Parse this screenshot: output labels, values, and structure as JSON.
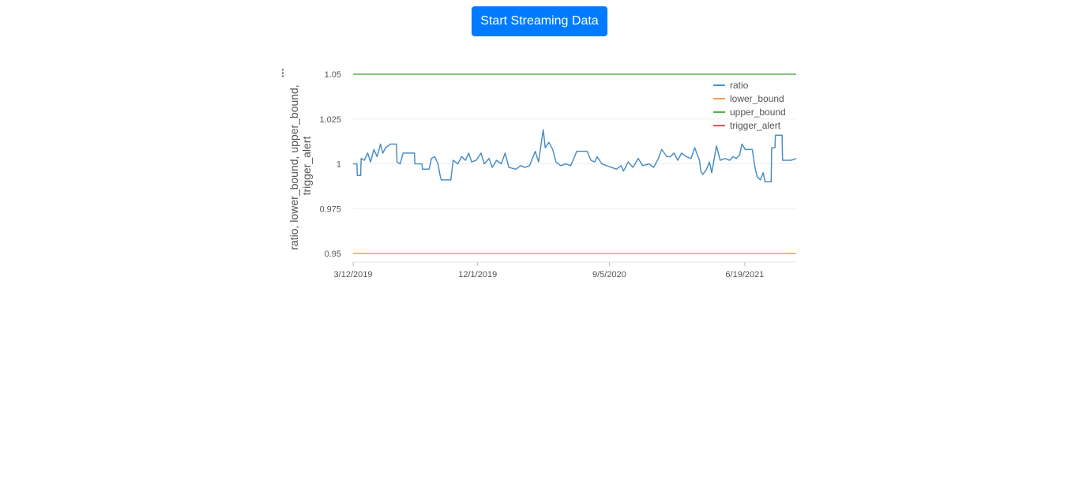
{
  "toolbar": {
    "stream_label": "Start Streaming Data"
  },
  "menu": {
    "icon": "kebab-menu-icon"
  },
  "colors": {
    "button": "#007bff",
    "ratio": "#4c8fc4",
    "lower_bound": "#f5a04a",
    "upper_bound": "#5aae52",
    "trigger_alert": "#e8524a"
  },
  "chart_data": {
    "type": "line",
    "title": "",
    "xlabel": "",
    "ylabel": "ratio, lower_bound, upper_bound, trigger_alert",
    "ylabel_lines": [
      "ratio, lower_bound, upper_bound,",
      "trigger_alert"
    ],
    "x_range": [
      "2019-03-12",
      "2021-10-06"
    ],
    "x_ticks": [
      "3/12/2019",
      "12/1/2019",
      "9/5/2020",
      "6/19/2021"
    ],
    "x_tick_dates": [
      "2019-03-12",
      "2019-12-01",
      "2020-09-05",
      "2021-06-19"
    ],
    "ylim": [
      0.95,
      1.05
    ],
    "y_ticks": [
      "1.05",
      "1.025",
      "1",
      "0.975",
      "0.95"
    ],
    "y_tick_values": [
      1.05,
      1.025,
      1.0,
      0.975,
      0.95
    ],
    "grid": true,
    "legend_position": "top-right",
    "series": [
      {
        "name": "ratio",
        "color": "#4c8fc4",
        "points": [
          [
            "2019-03-12",
            1.0
          ],
          [
            "2019-03-20",
            1.0
          ],
          [
            "2019-03-21",
            0.9935
          ],
          [
            "2019-03-28",
            0.9935
          ],
          [
            "2019-03-29",
            1.003
          ],
          [
            "2019-04-05",
            1.002
          ],
          [
            "2019-04-12",
            1.006
          ],
          [
            "2019-04-18",
            1.001
          ],
          [
            "2019-04-25",
            1.008
          ],
          [
            "2019-05-02",
            1.004
          ],
          [
            "2019-05-09",
            1.011
          ],
          [
            "2019-05-14",
            1.006
          ],
          [
            "2019-05-20",
            1.009
          ],
          [
            "2019-05-30",
            1.011
          ],
          [
            "2019-06-12",
            1.011
          ],
          [
            "2019-06-13",
            1.001
          ],
          [
            "2019-06-20",
            1.0
          ],
          [
            "2019-06-26",
            1.006
          ],
          [
            "2019-07-20",
            1.006
          ],
          [
            "2019-07-21",
            1.0
          ],
          [
            "2019-08-05",
            1.0
          ],
          [
            "2019-08-06",
            0.997
          ],
          [
            "2019-08-20",
            0.997
          ],
          [
            "2019-08-25",
            1.003
          ],
          [
            "2019-09-01",
            1.004
          ],
          [
            "2019-09-08",
            1.0
          ],
          [
            "2019-09-12",
            0.994
          ],
          [
            "2019-09-15",
            0.991
          ],
          [
            "2019-10-05",
            0.991
          ],
          [
            "2019-10-10",
            1.002
          ],
          [
            "2019-10-20",
            1.0
          ],
          [
            "2019-10-28",
            1.004
          ],
          [
            "2019-11-05",
            1.002
          ],
          [
            "2019-11-12",
            1.006
          ],
          [
            "2019-11-18",
            1.001
          ],
          [
            "2019-11-28",
            1.002
          ],
          [
            "2019-12-08",
            1.006
          ],
          [
            "2019-12-15",
            1.0
          ],
          [
            "2019-12-25",
            1.003
          ],
          [
            "2020-01-01",
            0.998
          ],
          [
            "2020-01-10",
            1.002
          ],
          [
            "2020-01-20",
            1.0
          ],
          [
            "2020-01-28",
            1.006
          ],
          [
            "2020-02-05",
            0.998
          ],
          [
            "2020-02-20",
            0.997
          ],
          [
            "2020-03-01",
            0.999
          ],
          [
            "2020-03-10",
            0.998
          ],
          [
            "2020-03-20",
            0.999
          ],
          [
            "2020-04-01",
            1.007
          ],
          [
            "2020-04-08",
            1.001
          ],
          [
            "2020-04-15",
            1.014
          ],
          [
            "2020-04-18",
            1.019
          ],
          [
            "2020-04-22",
            1.009
          ],
          [
            "2020-04-30",
            1.012
          ],
          [
            "2020-05-08",
            1.008
          ],
          [
            "2020-05-15",
            1.001
          ],
          [
            "2020-05-25",
            0.999
          ],
          [
            "2020-06-05",
            1.0
          ],
          [
            "2020-06-15",
            0.999
          ],
          [
            "2020-06-20",
            1.002
          ],
          [
            "2020-06-28",
            1.007
          ],
          [
            "2020-07-20",
            1.007
          ],
          [
            "2020-07-28",
            1.002
          ],
          [
            "2020-08-05",
            1.001
          ],
          [
            "2020-08-10",
            1.004
          ],
          [
            "2020-08-20",
            1.0
          ],
          [
            "2020-08-30",
            0.999
          ],
          [
            "2020-09-10",
            0.998
          ],
          [
            "2020-09-20",
            0.997
          ],
          [
            "2020-09-30",
            0.999
          ],
          [
            "2020-10-05",
            0.996
          ],
          [
            "2020-10-15",
            1.001
          ],
          [
            "2020-10-25",
            0.998
          ],
          [
            "2020-11-05",
            1.003
          ],
          [
            "2020-11-15",
            0.999
          ],
          [
            "2020-11-28",
            1.0
          ],
          [
            "2020-12-08",
            0.998
          ],
          [
            "2020-12-18",
            1.003
          ],
          [
            "2020-12-25",
            1.008
          ],
          [
            "2021-01-05",
            1.004
          ],
          [
            "2021-01-12",
            1.004
          ],
          [
            "2021-01-20",
            1.006
          ],
          [
            "2021-01-28",
            1.002
          ],
          [
            "2021-02-05",
            1.006
          ],
          [
            "2021-02-15",
            1.004
          ],
          [
            "2021-02-25",
            1.003
          ],
          [
            "2021-03-05",
            1.009
          ],
          [
            "2021-03-15",
            1.002
          ],
          [
            "2021-03-18",
            0.996
          ],
          [
            "2021-03-22",
            0.994
          ],
          [
            "2021-03-30",
            0.997
          ],
          [
            "2021-04-05",
            1.001
          ],
          [
            "2021-04-10",
            0.995
          ],
          [
            "2021-04-20",
            1.01
          ],
          [
            "2021-04-28",
            1.002
          ],
          [
            "2021-05-08",
            1.003
          ],
          [
            "2021-05-18",
            1.002
          ],
          [
            "2021-05-25",
            1.004
          ],
          [
            "2021-06-01",
            1.003
          ],
          [
            "2021-06-08",
            1.005
          ],
          [
            "2021-06-13",
            1.011
          ],
          [
            "2021-06-20",
            1.008
          ],
          [
            "2021-07-05",
            1.008
          ],
          [
            "2021-07-10",
            0.999
          ],
          [
            "2021-07-15",
            0.993
          ],
          [
            "2021-07-22",
            0.991
          ],
          [
            "2021-07-28",
            0.995
          ],
          [
            "2021-08-01",
            0.99
          ],
          [
            "2021-08-14",
            0.99
          ],
          [
            "2021-08-15",
            1.009
          ],
          [
            "2021-08-22",
            1.009
          ],
          [
            "2021-08-23",
            1.016
          ],
          [
            "2021-09-06",
            1.016
          ],
          [
            "2021-09-07",
            1.002
          ],
          [
            "2021-09-25",
            1.002
          ],
          [
            "2021-10-06",
            1.003
          ]
        ]
      },
      {
        "name": "lower_bound",
        "color": "#f5a04a",
        "points": [
          [
            "2019-03-12",
            0.95
          ],
          [
            "2021-10-06",
            0.95
          ]
        ]
      },
      {
        "name": "upper_bound",
        "color": "#5aae52",
        "points": [
          [
            "2019-03-12",
            1.05
          ],
          [
            "2021-10-06",
            1.05
          ]
        ]
      },
      {
        "name": "trigger_alert",
        "color": "#e8524a",
        "points": []
      }
    ]
  }
}
